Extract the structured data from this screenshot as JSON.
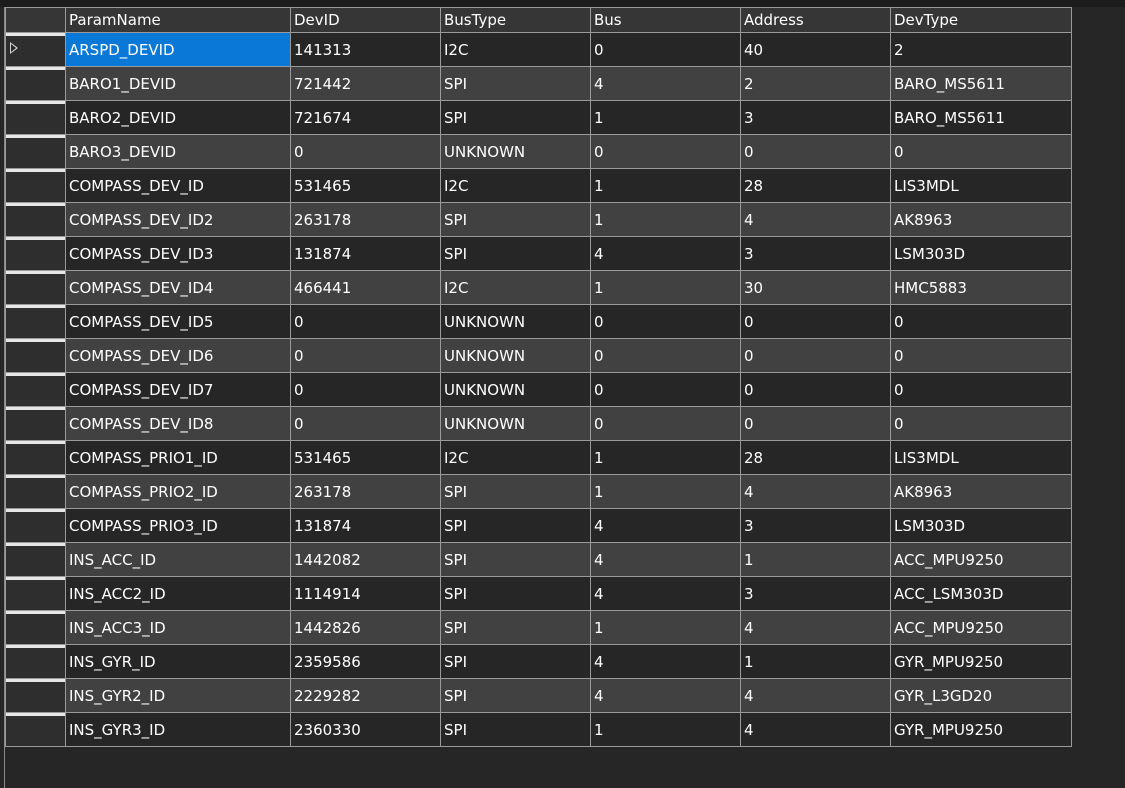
{
  "grid": {
    "columns": [
      "ParamName",
      "DevID",
      "BusType",
      "Bus",
      "Address",
      "DevType"
    ],
    "selected_row": 0,
    "rows": [
      [
        "ARSPD_DEVID",
        "141313",
        "I2C",
        "0",
        "40",
        "2"
      ],
      [
        "BARO1_DEVID",
        "721442",
        "SPI",
        "4",
        "2",
        "BARO_MS5611"
      ],
      [
        "BARO2_DEVID",
        "721674",
        "SPI",
        "1",
        "3",
        "BARO_MS5611"
      ],
      [
        "BARO3_DEVID",
        "0",
        "UNKNOWN",
        "0",
        "0",
        "0"
      ],
      [
        "COMPASS_DEV_ID",
        "531465",
        "I2C",
        "1",
        "28",
        "LIS3MDL"
      ],
      [
        "COMPASS_DEV_ID2",
        "263178",
        "SPI",
        "1",
        "4",
        "AK8963"
      ],
      [
        "COMPASS_DEV_ID3",
        "131874",
        "SPI",
        "4",
        "3",
        "LSM303D"
      ],
      [
        "COMPASS_DEV_ID4",
        "466441",
        "I2C",
        "1",
        "30",
        "HMC5883"
      ],
      [
        "COMPASS_DEV_ID5",
        "0",
        "UNKNOWN",
        "0",
        "0",
        "0"
      ],
      [
        "COMPASS_DEV_ID6",
        "0",
        "UNKNOWN",
        "0",
        "0",
        "0"
      ],
      [
        "COMPASS_DEV_ID7",
        "0",
        "UNKNOWN",
        "0",
        "0",
        "0"
      ],
      [
        "COMPASS_DEV_ID8",
        "0",
        "UNKNOWN",
        "0",
        "0",
        "0"
      ],
      [
        "COMPASS_PRIO1_ID",
        "531465",
        "I2C",
        "1",
        "28",
        "LIS3MDL"
      ],
      [
        "COMPASS_PRIO2_ID",
        "263178",
        "SPI",
        "1",
        "4",
        "AK8963"
      ],
      [
        "COMPASS_PRIO3_ID",
        "131874",
        "SPI",
        "4",
        "3",
        "LSM303D"
      ],
      [
        "INS_ACC_ID",
        "1442082",
        "SPI",
        "4",
        "1",
        "ACC_MPU9250"
      ],
      [
        "INS_ACC2_ID",
        "1114914",
        "SPI",
        "4",
        "3",
        "ACC_LSM303D"
      ],
      [
        "INS_ACC3_ID",
        "1442826",
        "SPI",
        "1",
        "4",
        "ACC_MPU9250"
      ],
      [
        "INS_GYR_ID",
        "2359586",
        "SPI",
        "4",
        "1",
        "GYR_MPU9250"
      ],
      [
        "INS_GYR2_ID",
        "2229282",
        "SPI",
        "4",
        "4",
        "GYR_L3GD20"
      ],
      [
        "INS_GYR3_ID",
        "2360330",
        "SPI",
        "1",
        "4",
        "GYR_MPU9250"
      ]
    ]
  },
  "colors": {
    "selection": "#0a78d7",
    "row_odd": "#262626",
    "row_even": "#414141"
  },
  "icons": {
    "current_row": "row-pointer-icon"
  }
}
